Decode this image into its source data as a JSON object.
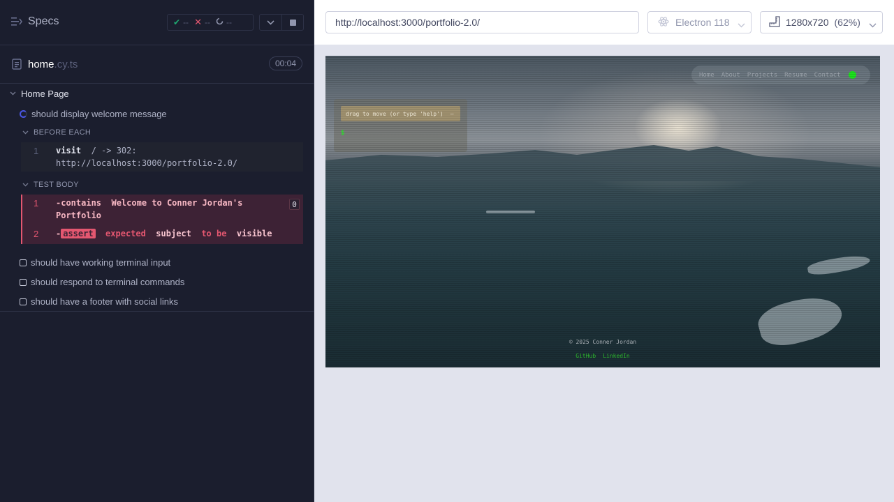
{
  "reporter": {
    "specs_label": "Specs",
    "stats": {
      "passed": "--",
      "failed": "--",
      "pending": "--"
    },
    "colors": {
      "passed": "#1fa971",
      "failed": "#e45770",
      "running": "#4956e3"
    },
    "file": {
      "name": "home",
      "ext": ".cy.ts",
      "duration": "00:04"
    },
    "suite": {
      "title": "Home Page",
      "tests": [
        {
          "title": "should display welcome message",
          "state": "running"
        },
        {
          "title": "should have working terminal input",
          "state": "pending"
        },
        {
          "title": "should respond to terminal commands",
          "state": "pending"
        },
        {
          "title": "should have a footer with social links",
          "state": "pending"
        }
      ]
    },
    "before_each": {
      "title": "BEFORE EACH",
      "commands": [
        {
          "num": "1",
          "name": "visit",
          "message_line1": "/ -> 302:",
          "message_line2": "http://localhost:3000/portfolio-2.0/"
        }
      ]
    },
    "test_body": {
      "title": "TEST BODY",
      "commands": [
        {
          "num": "1",
          "prefix": "-",
          "name": "contains",
          "message_line1": "Welcome to Conner Jordan's",
          "message_line2": "Portfolio",
          "badge": "0"
        },
        {
          "num": "2",
          "prefix": "-",
          "name": "assert",
          "words": [
            "expected",
            "subject",
            "to be",
            "visible"
          ]
        }
      ]
    }
  },
  "aut": {
    "url": "http://localhost:3000/portfolio-2.0/",
    "browser": "Electron 118",
    "viewport": "1280x720",
    "viewport_scale": "(62%)"
  },
  "site": {
    "nav": [
      "Home",
      "About",
      "Projects",
      "Resume",
      "Contact"
    ],
    "terminal_title": "drag to move (or type 'help')",
    "terminal_minimize": "—",
    "terminal_prompt": "$",
    "footer": "© 2025 Conner Jordan",
    "links": [
      "GitHub",
      "LinkedIn"
    ]
  }
}
